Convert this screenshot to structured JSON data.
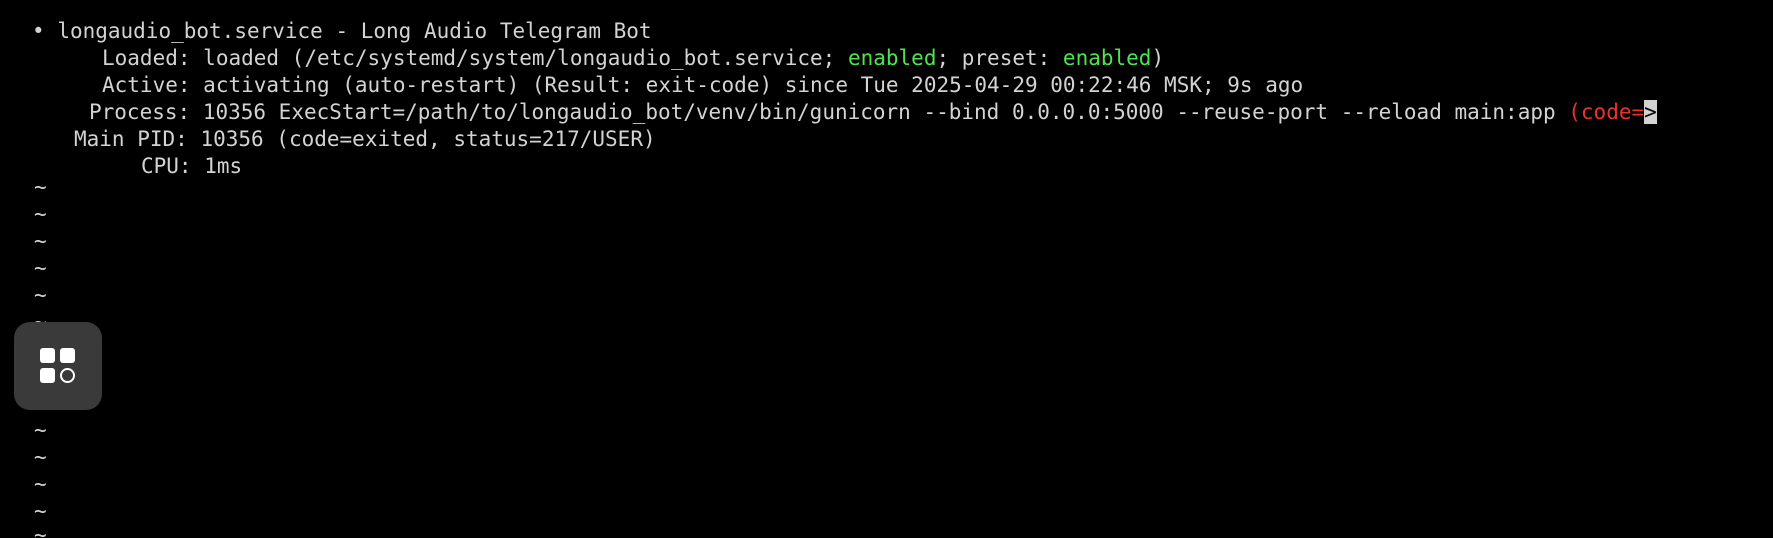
{
  "status": {
    "bullet": "•",
    "title": "longaudio_bot.service - Long Audio Telegram Bot",
    "loaded": {
      "label": "Loaded:",
      "pre": "loaded (/etc/systemd/system/longaudio_bot.service; ",
      "enabled1": "enabled",
      "mid": "; preset: ",
      "enabled2": "enabled",
      "post": ")"
    },
    "active": {
      "label": "Active:",
      "value": "activating (auto-restart) (Result: exit-code) since Tue 2025-04-29 00:22:46 MSK; 9s ago"
    },
    "process": {
      "label": "Process:",
      "value": "10356 ExecStart=/path/to/longaudio_bot/venv/bin/gunicorn --bind 0.0.0.0:5000 --reuse-port --reload main:app ",
      "code": "(code=",
      "cursor": ">"
    },
    "main_pid": {
      "label": "Main PID:",
      "value": "10356 (code=exited, status=217/USER)"
    },
    "cpu": {
      "label": "CPU:",
      "value": "1ms"
    }
  },
  "pager": {
    "tilde": "~"
  },
  "colors": {
    "background": "#000000",
    "text": "#d3d3d3",
    "enabled": "#4ee44e",
    "error": "#e8332a",
    "switcher_bg": "#3a3a3a"
  },
  "icons": {
    "app_switcher": "app-switcher-icon"
  }
}
